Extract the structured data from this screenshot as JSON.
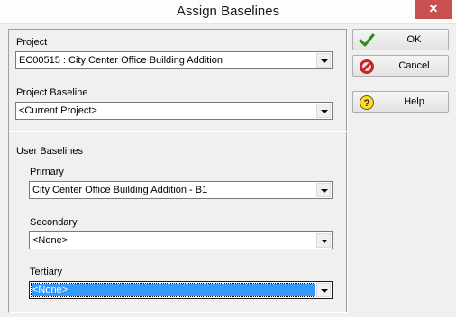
{
  "window": {
    "title": "Assign Baselines",
    "close_glyph": "✕"
  },
  "project": {
    "label": "Project",
    "value": "EC00515 : City Center Office Building Addition"
  },
  "project_baseline": {
    "label": "Project Baseline",
    "value": "<Current Project>"
  },
  "user_baselines": {
    "heading": "User Baselines",
    "primary": {
      "label": "Primary",
      "value": "City Center Office Building Addition - B1"
    },
    "secondary": {
      "label": "Secondary",
      "value": "<None>"
    },
    "tertiary": {
      "label": "Tertiary",
      "value": "<None>"
    }
  },
  "buttons": {
    "ok": {
      "label": "OK",
      "icon": "checkmark-icon",
      "color": "#2e8b1f"
    },
    "cancel": {
      "label": "Cancel",
      "icon": "prohibited-icon",
      "color": "#d21f1f"
    },
    "help": {
      "label": "Help",
      "icon": "help-icon",
      "color": "#e6c200"
    }
  }
}
